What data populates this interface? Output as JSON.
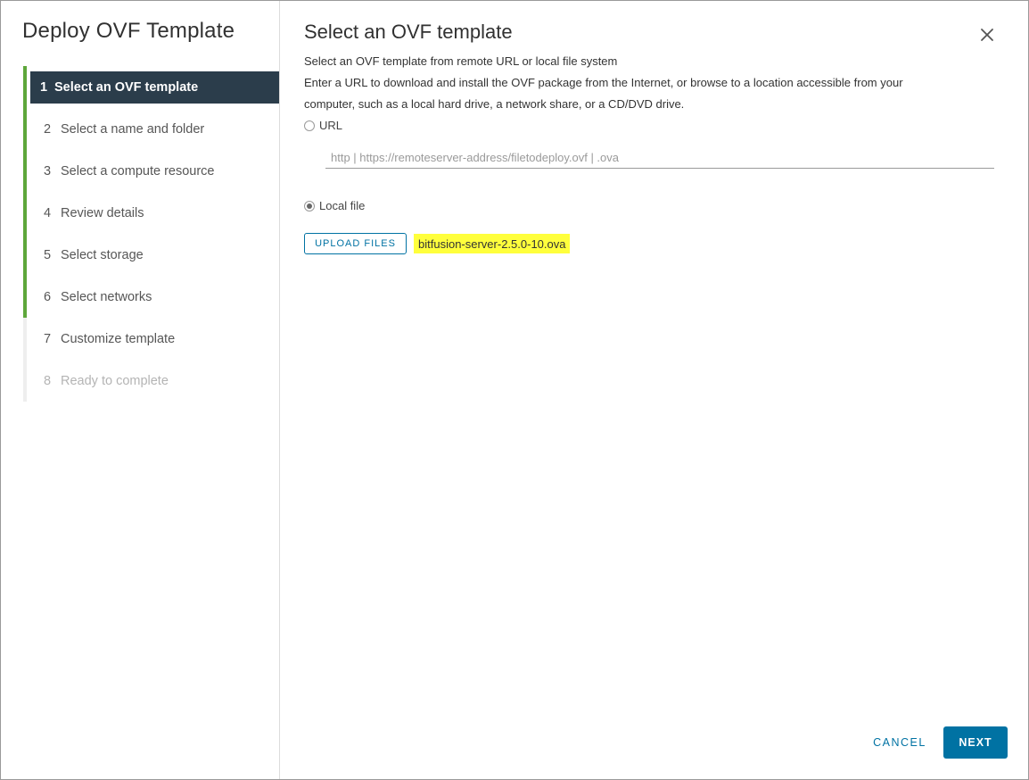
{
  "wizard": {
    "title": "Deploy OVF Template",
    "steps": [
      {
        "num": "1",
        "label": "Select an OVF template",
        "state": "active"
      },
      {
        "num": "2",
        "label": "Select a name and folder",
        "state": "done"
      },
      {
        "num": "3",
        "label": "Select a compute resource",
        "state": "done"
      },
      {
        "num": "4",
        "label": "Review details",
        "state": "done"
      },
      {
        "num": "5",
        "label": "Select storage",
        "state": "done"
      },
      {
        "num": "6",
        "label": "Select networks",
        "state": "done"
      },
      {
        "num": "7",
        "label": "Customize template",
        "state": "pending"
      },
      {
        "num": "8",
        "label": "Ready to complete",
        "state": "disabled"
      }
    ]
  },
  "page": {
    "title": "Select an OVF template",
    "subtitle": "Select an OVF template from remote URL or local file system",
    "description_line1": "Enter a URL to download and install the OVF package from the Internet, or browse to a location accessible from your",
    "description_line2": "computer, such as a local hard drive, a network share, or a CD/DVD drive.",
    "url_option": {
      "label": "URL",
      "checked": false
    },
    "url_input": {
      "value": "",
      "placeholder": "http | https://remoteserver-address/filetodeploy.ovf | .ova"
    },
    "local_option": {
      "label": "Local file",
      "checked": true
    },
    "upload_button": "UPLOAD FILES",
    "selected_file": "bitfusion-server-2.5.0-10.ova"
  },
  "footer": {
    "cancel_label": "CANCEL",
    "next_label": "NEXT"
  },
  "icons": {
    "close": "close-icon"
  },
  "colors": {
    "accent": "#0072a3",
    "step_done": "#5ea73b",
    "step_active_bg": "#2b3d4b",
    "file_highlight": "#ffff3c"
  }
}
